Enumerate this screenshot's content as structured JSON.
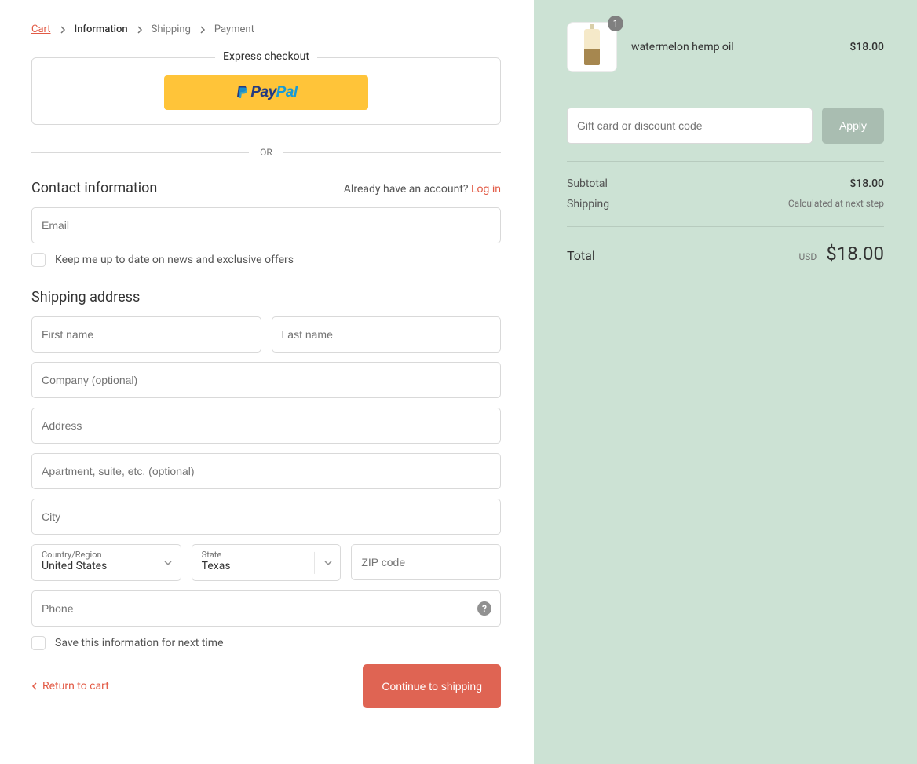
{
  "breadcrumb": {
    "cart": "Cart",
    "information": "Information",
    "shipping": "Shipping",
    "payment": "Payment"
  },
  "express": {
    "label": "Express checkout",
    "paypal_brand_pay": "Pay",
    "paypal_brand_pal": "Pal"
  },
  "divider_or": "OR",
  "contact": {
    "heading": "Contact information",
    "have_account": "Already have an account?",
    "log_in": "Log in",
    "email_placeholder": "Email",
    "newsletter_label": "Keep me up to date on news and exclusive offers"
  },
  "shipping": {
    "heading": "Shipping address",
    "first_name_placeholder": "First name",
    "last_name_placeholder": "Last name",
    "company_placeholder": "Company (optional)",
    "address_placeholder": "Address",
    "apartment_placeholder": "Apartment, suite, etc. (optional)",
    "city_placeholder": "City",
    "country_label": "Country/Region",
    "country_value": "United States",
    "state_label": "State",
    "state_value": "Texas",
    "zip_placeholder": "ZIP code",
    "phone_placeholder": "Phone",
    "save_info_label": "Save this information for next time"
  },
  "actions": {
    "return_label": "Return to cart",
    "continue_label": "Continue to shipping"
  },
  "order": {
    "item_name": "watermelon hemp oil",
    "item_qty": "1",
    "item_price": "$18.00",
    "discount_placeholder": "Gift card or discount code",
    "apply_label": "Apply",
    "subtotal_label": "Subtotal",
    "subtotal_value": "$18.00",
    "shipping_label": "Shipping",
    "shipping_value": "Calculated at next step",
    "total_label": "Total",
    "currency": "USD",
    "total_value": "$18.00"
  }
}
